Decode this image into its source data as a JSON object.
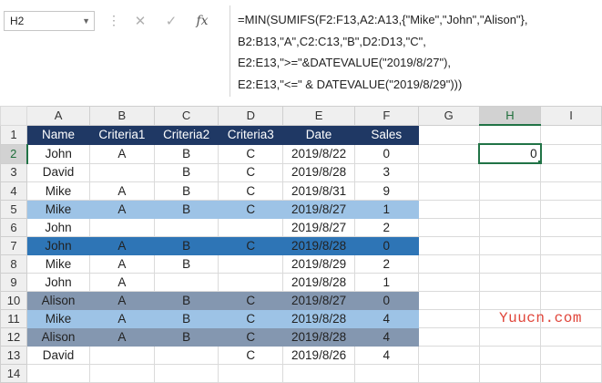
{
  "name_box": "H2",
  "formula_lines": [
    "=MIN(SUMIFS(F2:F13,A2:A13,{\"Mike\",\"John\",\"Alison\"},",
    "B2:B13,\"A\",C2:C13,\"B\",D2:D13,\"C\",",
    "E2:E13,\">=\"&DATEVALUE(\"2019/8/27\"),",
    "E2:E13,\"<=\" & DATEVALUE(\"2019/8/29\")))"
  ],
  "toolbar": {
    "cancel": "✕",
    "enter": "✓",
    "fx": "fx",
    "dots": "⋮"
  },
  "columns": [
    "A",
    "B",
    "C",
    "D",
    "E",
    "F",
    "G",
    "H",
    "I"
  ],
  "rows": [
    {
      "num": "1",
      "cells": [
        "Name",
        "Criteria1",
        "Criteria2",
        "Criteria3",
        "Date",
        "Sales",
        "",
        "",
        ""
      ]
    },
    {
      "num": "2",
      "cells": [
        "John",
        "A",
        "B",
        "C",
        "2019/8/22",
        "0",
        "",
        "0",
        ""
      ]
    },
    {
      "num": "3",
      "cells": [
        "David",
        "",
        "B",
        "C",
        "2019/8/28",
        "3",
        "",
        "",
        ""
      ]
    },
    {
      "num": "4",
      "cells": [
        "Mike",
        "A",
        "B",
        "C",
        "2019/8/31",
        "9",
        "",
        "",
        ""
      ]
    },
    {
      "num": "5",
      "cells": [
        "Mike",
        "A",
        "B",
        "C",
        "2019/8/27",
        "1",
        "",
        "",
        ""
      ]
    },
    {
      "num": "6",
      "cells": [
        "John",
        "",
        "",
        "",
        "2019/8/27",
        "2",
        "",
        "",
        ""
      ]
    },
    {
      "num": "7",
      "cells": [
        "John",
        "A",
        "B",
        "C",
        "2019/8/28",
        "0",
        "",
        "",
        ""
      ]
    },
    {
      "num": "8",
      "cells": [
        "Mike",
        "A",
        "B",
        "",
        "2019/8/29",
        "2",
        "",
        "",
        ""
      ]
    },
    {
      "num": "9",
      "cells": [
        "John",
        "A",
        "",
        "",
        "2019/8/28",
        "1",
        "",
        "",
        ""
      ]
    },
    {
      "num": "10",
      "cells": [
        "Alison",
        "A",
        "B",
        "C",
        "2019/8/27",
        "0",
        "",
        "",
        ""
      ]
    },
    {
      "num": "11",
      "cells": [
        "Mike",
        "A",
        "B",
        "C",
        "2019/8/28",
        "4",
        "",
        "",
        ""
      ]
    },
    {
      "num": "12",
      "cells": [
        "Alison",
        "A",
        "B",
        "C",
        "2019/8/28",
        "4",
        "",
        "",
        ""
      ]
    },
    {
      "num": "13",
      "cells": [
        "David",
        "",
        "",
        "C",
        "2019/8/26",
        "4",
        "",
        "",
        ""
      ]
    },
    {
      "num": "14",
      "cells": [
        "",
        "",
        "",
        "",
        "",
        "",
        "",
        "",
        ""
      ]
    }
  ],
  "watermark": "Yuucn.com",
  "colors": {
    "header_fill": "#1f3864",
    "light_blue": "#9dc3e6",
    "dark_blue": "#2e75b6",
    "gray_blue": "#8497b0",
    "selection": "#217346"
  }
}
